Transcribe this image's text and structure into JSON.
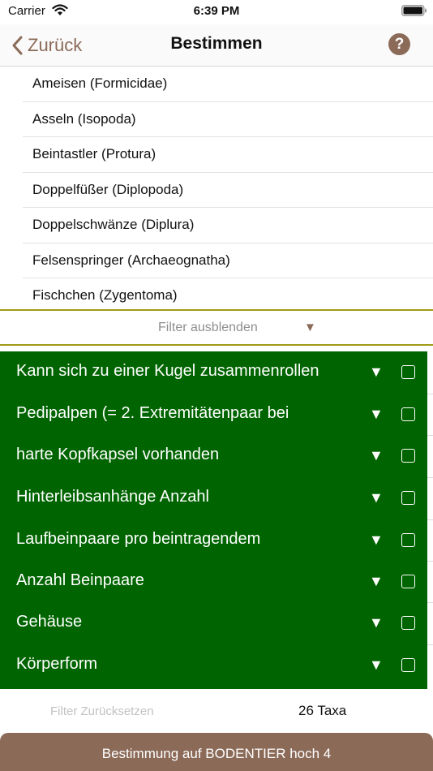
{
  "status_bar": {
    "carrier": "Carrier",
    "time": "6:39 PM"
  },
  "nav": {
    "back_label": "Zurück",
    "title": "Bestimmen",
    "help_label": "?"
  },
  "taxa_list": [
    "Ameisen (Formicidae)",
    "Asseln (Isopoda)",
    "Beintastler (Protura)",
    "Doppelfüßer (Diplopoda)",
    "Doppelschwänze (Diplura)",
    "Felsenspringer (Archaeognatha)",
    "Fischchen (Zygentoma)"
  ],
  "filter_toggle": {
    "label": "Filter ausblenden",
    "arrow": "▼"
  },
  "criteria": [
    {
      "label": "Kann sich zu einer Kugel zusammenrollen",
      "arrow": "▼",
      "checked": false
    },
    {
      "label": "Pedipalpen (= 2. Extremitätenpaar bei",
      "arrow": "▼",
      "checked": false
    },
    {
      "label": "harte Kopfkapsel vorhanden",
      "arrow": "▼",
      "checked": false
    },
    {
      "label": "Hinterleibsanhänge Anzahl",
      "arrow": "▼",
      "checked": false
    },
    {
      "label": "Laufbeinpaare pro beintragendem",
      "arrow": "▼",
      "checked": false
    },
    {
      "label": "Anzahl Beinpaare",
      "arrow": "▼",
      "checked": false
    },
    {
      "label": "Gehäuse",
      "arrow": "▼",
      "checked": false
    },
    {
      "label": "Körperform",
      "arrow": "▼",
      "checked": false
    }
  ],
  "bottom": {
    "reset_label": "Filter Zurücksetzen",
    "taxa_count": "26 Taxa",
    "determine_label": "Bestimmung auf BODENTIER hoch 4"
  },
  "colors": {
    "accent_brown": "#8b6a58",
    "panel_green": "#006400",
    "divider_olive": "#a09b18"
  },
  "icons": {
    "wifi": "wifi-icon",
    "battery": "battery-icon",
    "back": "chevron-left-icon",
    "help": "question-circle-icon",
    "dropdown": "triangle-down-icon",
    "checkbox": "checkbox-icon"
  }
}
